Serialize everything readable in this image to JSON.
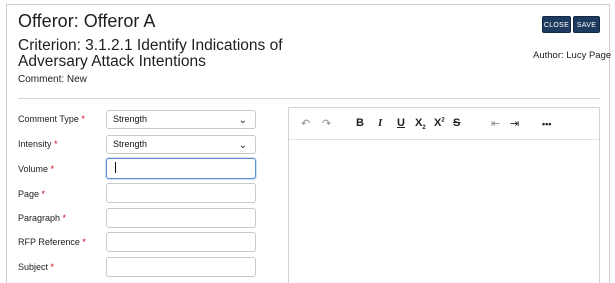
{
  "header": {
    "offeror": "Offeror: Offeror A",
    "criterion": "Criterion: 3.1.2.1 Identify Indications of Adversary Attack Intentions",
    "comment_status": "Comment: New",
    "author": "Author: Lucy Page",
    "close_label": "CLOSE",
    "save_label": "SAVE"
  },
  "form": {
    "comment_type": {
      "label": "Comment Type",
      "value": "Strength"
    },
    "intensity": {
      "label": "Intensity",
      "value": "Strength"
    },
    "volume": {
      "label": "Volume",
      "value": ""
    },
    "page": {
      "label": "Page",
      "value": ""
    },
    "paragraph": {
      "label": "Paragraph",
      "value": ""
    },
    "rfp_reference": {
      "label": "RFP Reference",
      "value": ""
    },
    "subject": {
      "label": "Subject",
      "value": ""
    },
    "required_mark": "*"
  },
  "editor": {
    "toolbar": {
      "undo": "↶",
      "redo": "↷",
      "bold": "B",
      "italic": "I",
      "underline": "U",
      "subscript": "X",
      "sub_mark": "2",
      "superscript": "X",
      "sup_mark": "2",
      "strikethrough": "S",
      "outdent": "⇤",
      "indent": "⇥",
      "more": "•••"
    }
  }
}
